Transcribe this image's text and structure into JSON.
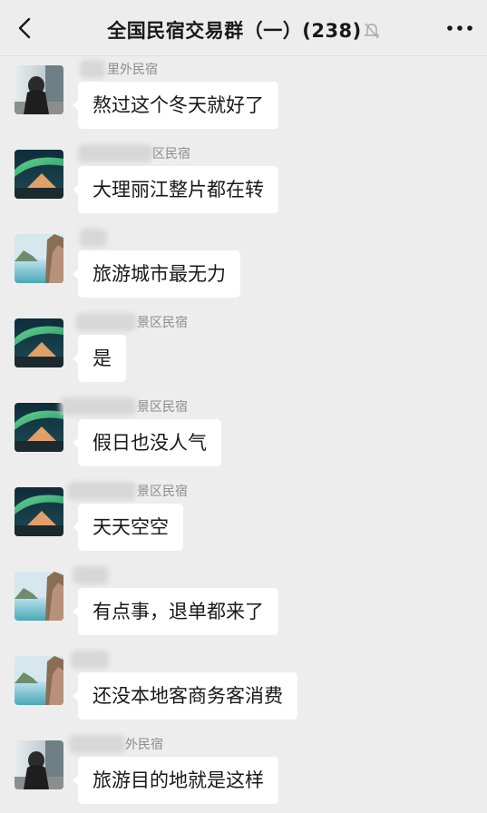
{
  "header": {
    "title": "全国民宿交易群（一）(238)",
    "back_icon": "chevron-left-icon",
    "mute_icon": "bell-off-icon",
    "more_icon": "more-dots-icon"
  },
  "messages": [
    {
      "sender": "里外民宿",
      "avatar": "person-dog-photo",
      "text": "熬过这个冬天就好了"
    },
    {
      "sender": "区民宿",
      "avatar": "aurora-tent-photo",
      "text": "大理丽江整片都在转"
    },
    {
      "sender": "",
      "avatar": "coastal-cliff-photo",
      "text": "旅游城市最无力"
    },
    {
      "sender": "景区民宿",
      "avatar": "aurora-tent-photo",
      "text": "是"
    },
    {
      "sender": "景区民宿",
      "avatar": "aurora-tent-photo",
      "text": "假日也没人气"
    },
    {
      "sender": "景区民宿",
      "avatar": "aurora-tent-photo",
      "text": "天天空空"
    },
    {
      "sender": "",
      "avatar": "coastal-cliff-photo",
      "text": "有点事，退单都来了"
    },
    {
      "sender": "",
      "avatar": "coastal-cliff-photo",
      "text": "还没本地客商务客消费"
    },
    {
      "sender": "外民宿",
      "avatar": "person-dog-photo",
      "text": "旅游目的地就是这样"
    }
  ]
}
